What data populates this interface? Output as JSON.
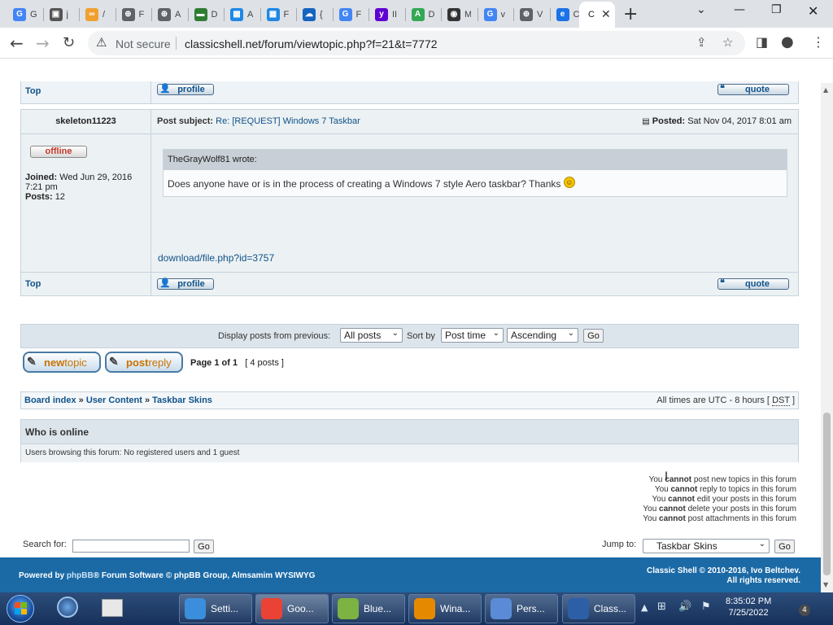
{
  "browser": {
    "tabs": [
      {
        "icon": "google-icon",
        "letter": "G",
        "color": "#4285f4",
        "label": "G"
      },
      {
        "icon": "puzzle-icon",
        "letter": "▣",
        "color": "#555555",
        "label": "j"
      },
      {
        "icon": "infinity-icon",
        "letter": "∞",
        "color": "#f0a030",
        "label": "/"
      },
      {
        "icon": "globe-icon",
        "letter": "⊕",
        "color": "#5f6368",
        "label": "F"
      },
      {
        "icon": "globe-icon",
        "letter": "⊕",
        "color": "#5f6368",
        "label": "A"
      },
      {
        "icon": "book-icon",
        "letter": "▬",
        "color": "#2e7d32",
        "label": "D"
      },
      {
        "icon": "grid-icon",
        "letter": "▦",
        "color": "#1e88e5",
        "label": "A"
      },
      {
        "icon": "grid-icon",
        "letter": "▦",
        "color": "#1e88e5",
        "label": "F"
      },
      {
        "icon": "cloud-icon",
        "letter": "☁",
        "color": "#1565c0",
        "label": "{"
      },
      {
        "icon": "google-icon",
        "letter": "G",
        "color": "#4285f4",
        "label": "F"
      },
      {
        "icon": "yahoo-icon",
        "letter": "y",
        "color": "#6001d2",
        "label": "II"
      },
      {
        "icon": "leaf-icon",
        "letter": "A",
        "color": "#34a853",
        "label": "D"
      },
      {
        "icon": "github-icon",
        "letter": "◉",
        "color": "#333333",
        "label": "M"
      },
      {
        "icon": "google-icon",
        "letter": "G",
        "color": "#4285f4",
        "label": "v"
      },
      {
        "icon": "globe-icon",
        "letter": "⊕",
        "color": "#5f6368",
        "label": "V"
      },
      {
        "icon": "edge-icon",
        "letter": "e",
        "color": "#1a73e8",
        "label": "C"
      }
    ],
    "active_tab_label": "C",
    "new_tab": "+",
    "not_secure": "Not secure",
    "url": "classicshell.net/forum/viewtopic.php?f=21&t=7772"
  },
  "prev_post": {
    "top_link": "Top",
    "profile": "profile",
    "quote": "quote"
  },
  "post": {
    "author": "skeleton11223",
    "status": "offline",
    "joined_label": "Joined:",
    "joined_value": "Wed Jun 29, 2016",
    "joined_time": "7:21 pm",
    "posts_label": "Posts:",
    "posts_value": "12",
    "subject_label": "Post subject:",
    "subject": "Re: [REQUEST] Windows 7 Taskbar",
    "posted_label": "Posted:",
    "posted_value": "Sat Nov 04, 2017 8:01 am",
    "quote_author": "TheGrayWolf81 wrote:",
    "quote_text": "Does anyone have or is in the process of creating a Windows 7 style Aero taskbar? Thanks",
    "download_link": "download/file.php?id=3757",
    "top_link": "Top",
    "profile": "profile",
    "quote": "quote"
  },
  "sort": {
    "display_label": "Display posts from previous:",
    "display_value": "All posts",
    "sortby_label": "Sort by",
    "sortby_value": "Post time",
    "order_value": "Ascending",
    "go": "Go"
  },
  "actions": {
    "newtopic_a": "new",
    "newtopic_b": "topic",
    "postreply_a": "post",
    "postreply_b": "reply",
    "page_label": "Page",
    "page_value": "1 of 1",
    "posts_count": "[ 4 posts ]"
  },
  "breadcrumb": {
    "board_index": "Board index",
    "sep1": "»",
    "user_content": "User Content",
    "sep2": "»",
    "taskbar_skins": "Taskbar Skins",
    "tz_text": "All times are UTC - 8 hours [",
    "tz_dst": "DST",
    "tz_end": "]"
  },
  "who_online": {
    "title": "Who is online",
    "text": "Users browsing this forum: No registered users and 1 guest"
  },
  "permissions": [
    {
      "pre": "You",
      "bold": "cannot",
      "post": "post new topics in this forum"
    },
    {
      "pre": "You",
      "bold": "cannot",
      "post": "reply to topics in this forum"
    },
    {
      "pre": "You",
      "bold": "cannot",
      "post": "edit your posts in this forum"
    },
    {
      "pre": "You",
      "bold": "cannot",
      "post": "delete your posts in this forum"
    },
    {
      "pre": "You",
      "bold": "cannot",
      "post": "post attachments in this forum"
    }
  ],
  "search": {
    "label": "Search for:",
    "value": "",
    "go": "Go"
  },
  "jump": {
    "label": "Jump to:",
    "value": "Taskbar Skins",
    "go": "Go"
  },
  "footer": {
    "powered_pre": "Powered by",
    "phpbb": "phpBB",
    "powered_post": "® Forum Software © phpBB Group, Almsamim WYSIWYG",
    "copyright": "Classic Shell © 2010-2016, Ivo Beltchev.",
    "rights": "All rights reserved."
  },
  "taskbar": {
    "tasks": [
      {
        "label": "Setti...",
        "icon": "settings-icon",
        "color": "#3b8edb"
      },
      {
        "label": "Goo...",
        "icon": "chrome-icon",
        "color": "#ea4335"
      },
      {
        "label": "Blue...",
        "icon": "bluestacks-icon",
        "color": "#7cb342"
      },
      {
        "label": "Wina...",
        "icon": "winamp-icon",
        "color": "#e58a00"
      },
      {
        "label": "Pers...",
        "icon": "personalize-icon",
        "color": "#5b8bd6"
      },
      {
        "label": "Class...",
        "icon": "notepad-icon",
        "color": "#2d5fa6"
      }
    ],
    "clock_time": "8:35:02 PM",
    "clock_date": "7/25/2022",
    "notifications": "4"
  }
}
